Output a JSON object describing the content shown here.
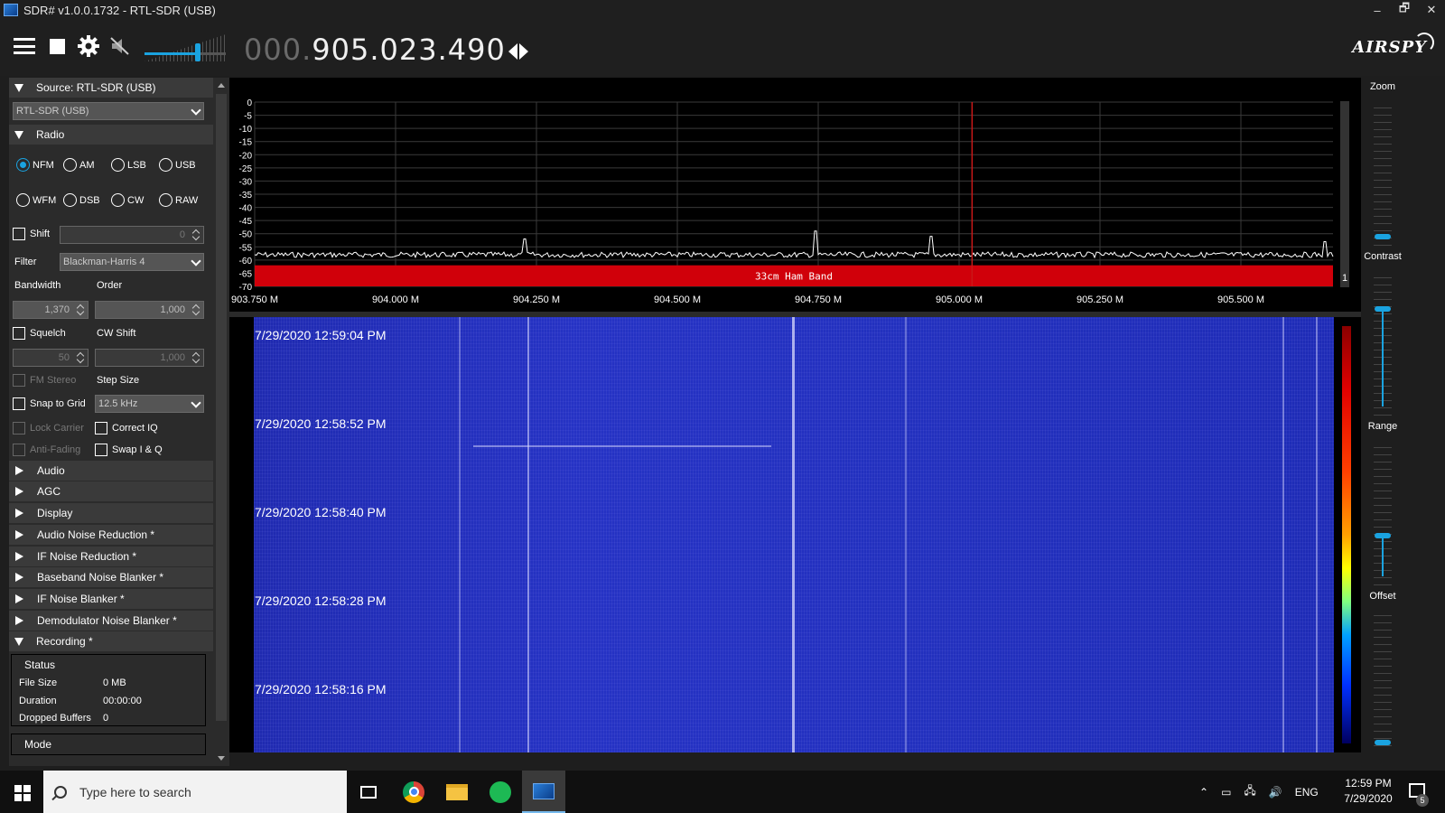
{
  "window": {
    "title": "SDR# v1.0.0.1732 - RTL-SDR (USB)",
    "minimize": "–",
    "restore": "🗗",
    "close": "✕"
  },
  "toolbar": {
    "freq_dim": "000.",
    "freq_main": "905.023.490",
    "volume_level": 0.65,
    "logo": "AIRSPY"
  },
  "source": {
    "header": "Source: RTL-SDR (USB)",
    "device": "RTL-SDR (USB)"
  },
  "radio": {
    "header": "Radio",
    "modes_row1": [
      "NFM",
      "AM",
      "LSB",
      "USB"
    ],
    "modes_row2": [
      "WFM",
      "DSB",
      "CW",
      "RAW"
    ],
    "selected": "NFM",
    "shift_label": "Shift",
    "shift_value": "0",
    "filter_label": "Filter",
    "filter_value": "Blackman-Harris 4",
    "bandwidth_label": "Bandwidth",
    "order_label": "Order",
    "bandwidth_value": "1,370",
    "order_value": "1,000",
    "squelch_label": "Squelch",
    "cw_shift_label": "CW Shift",
    "squelch_value": "50",
    "cw_shift_value": "1,000",
    "fm_stereo_label": "FM Stereo",
    "step_size_label": "Step Size",
    "snap_label": "Snap to Grid",
    "step_value": "12.5 kHz",
    "lock_carrier_label": "Lock Carrier",
    "correct_iq_label": "Correct IQ",
    "anti_fading_label": "Anti-Fading",
    "swap_iq_label": "Swap I & Q"
  },
  "sections": [
    "Audio",
    "AGC",
    "Display",
    "Audio Noise Reduction *",
    "IF Noise Reduction *",
    "Baseband Noise Blanker *",
    "IF Noise Blanker *",
    "Demodulator Noise Blanker *"
  ],
  "recording": {
    "header": "Recording *",
    "status_label": "Status",
    "file_size_label": "File Size",
    "file_size": "0 MB",
    "duration_label": "Duration",
    "duration": "00:00:00",
    "dropped_label": "Dropped Buffers",
    "dropped": "0",
    "mode_label": "Mode"
  },
  "spectrum": {
    "band_label": "33cm Ham Band",
    "y_ticks": [
      "0",
      "-5",
      "-10",
      "-15",
      "-20",
      "-25",
      "-30",
      "-35",
      "-40",
      "-45",
      "-50",
      "-55",
      "-60",
      "-65",
      "-70"
    ],
    "x_ticks": [
      "903.750 M",
      "904.000 M",
      "904.250 M",
      "904.500 M",
      "904.750 M",
      "905.000 M",
      "905.250 M",
      "905.500 M"
    ],
    "scroll_indicator": "1",
    "noise_floor_db": -58,
    "peaks": [
      {
        "freq": 904.23,
        "db": -52
      },
      {
        "freq": 904.745,
        "db": -49
      },
      {
        "freq": 904.95,
        "db": -51
      },
      {
        "freq": 905.65,
        "db": -53
      }
    ]
  },
  "waterfall": {
    "timestamps": [
      "7/29/2020 12:59:04 PM",
      "7/29/2020 12:58:52 PM",
      "7/29/2020 12:58:40 PM",
      "7/29/2020 12:58:28 PM",
      "7/29/2020 12:58:16 PM"
    ]
  },
  "right_panel": {
    "zoom_label": "Zoom",
    "contrast_label": "Contrast",
    "range_label": "Range",
    "offset_label": "Offset",
    "zoom_level": 0.0,
    "contrast_level": 0.72,
    "range_level": 0.3,
    "offset_level": 0.0
  },
  "taskbar": {
    "search_placeholder": "Type here to search",
    "lang": "ENG",
    "time": "12:59 PM",
    "date": "7/29/2020",
    "notifications": "5"
  },
  "colors": {
    "accent": "#1aa3e0",
    "band": "#d0000a",
    "waterfall": "#2230be"
  }
}
